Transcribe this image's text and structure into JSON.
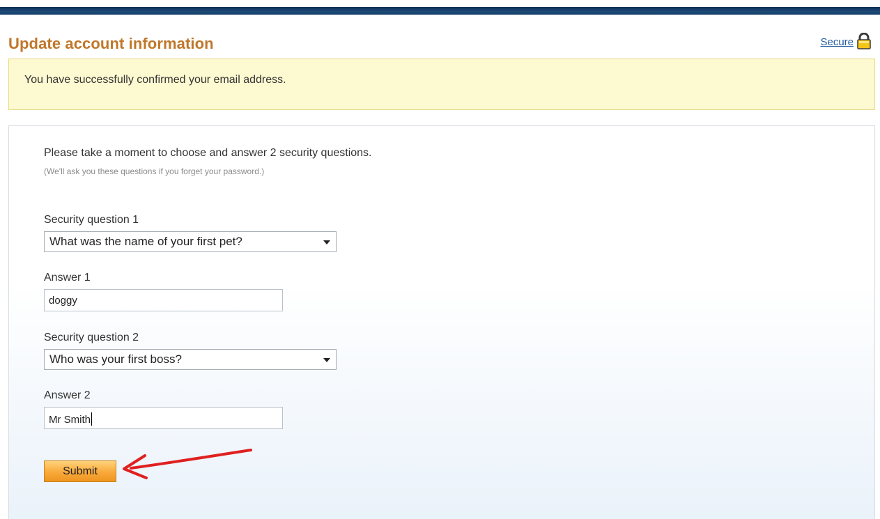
{
  "header": {
    "title": "Update account information",
    "secure_label": "Secure",
    "secure_icon": "lock-icon"
  },
  "notice": {
    "message": "You have successfully confirmed your email address."
  },
  "form": {
    "intro": "Please take a moment to choose and answer 2 security questions.",
    "intro_hint": "(We'll ask you these questions if you forget your password.)",
    "question1": {
      "label": "Security question 1",
      "selected": "What was the name of your first pet?"
    },
    "answer1": {
      "label": "Answer 1",
      "value": "doggy"
    },
    "question2": {
      "label": "Security question 2",
      "selected": "Who was your first boss?"
    },
    "answer2": {
      "label": "Answer 2",
      "value": "Mr Smith"
    },
    "submit_label": "Submit"
  },
  "colors": {
    "title": "#c0772a",
    "top_bar": "#143c64",
    "notice_bg": "#fdf9d0",
    "submit_bg": "#f8a93a",
    "annotation_arrow": "#e02020"
  }
}
